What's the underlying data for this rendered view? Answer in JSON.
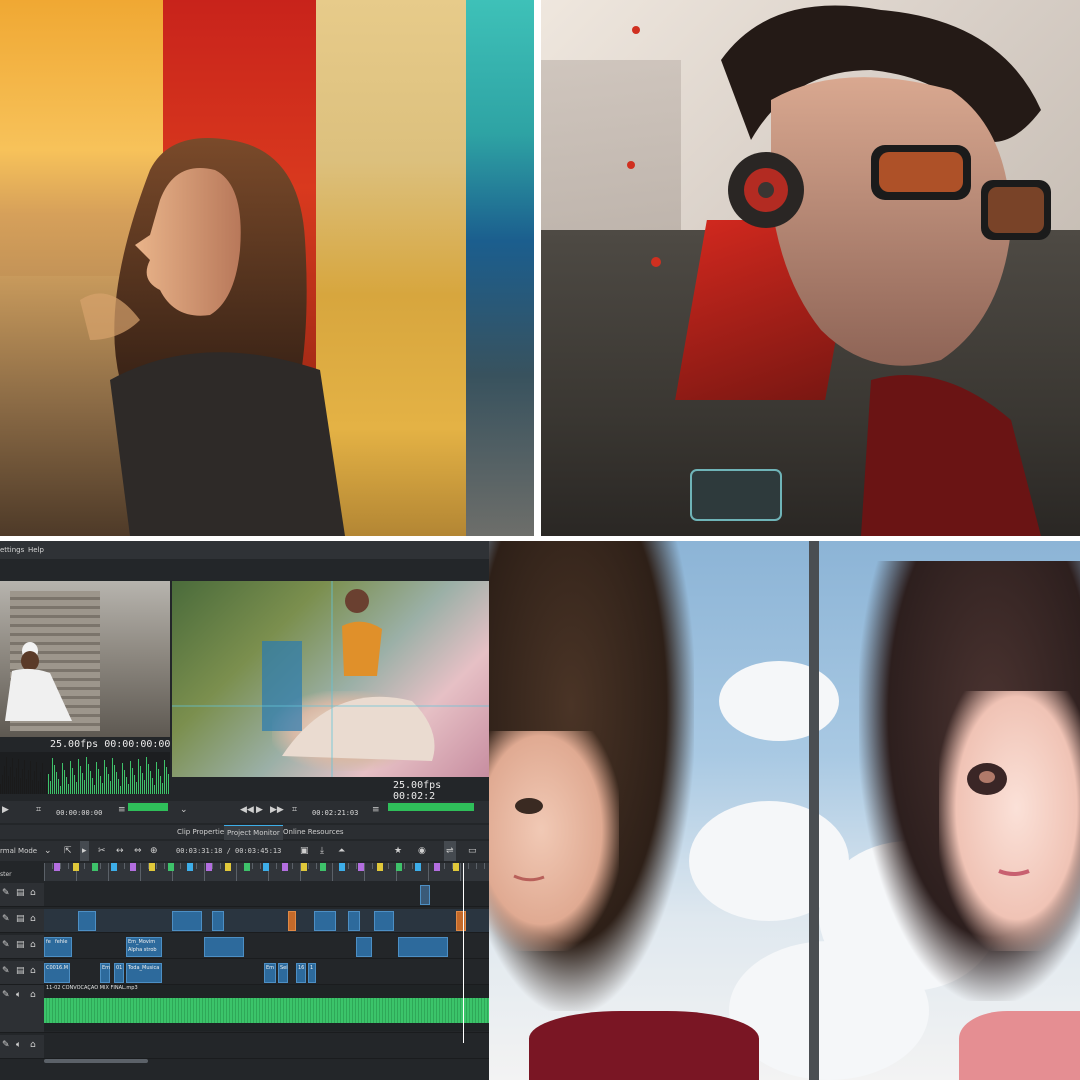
{
  "editor": {
    "menu": {
      "settings": "ettings",
      "help": "Help"
    },
    "clip_monitor": {
      "fps": "25.00fps",
      "timecode": "00:00:00:00",
      "ctrl_timecode": "00:00:00:00"
    },
    "project_monitor": {
      "fps": "25.00fps",
      "timecode": "00:02:2",
      "ctrl_timecode": "00:02:21:03"
    },
    "tabs": {
      "clip_properties": "Clip Properties",
      "project_monitor": "Project Monitor",
      "online_resources": "Online Resources"
    },
    "toolbar": {
      "mode": "rmal Mode",
      "position": "00:03:31:18 / 00:03:45:13"
    },
    "track_header": "ster",
    "clip_labels": [
      "fe",
      "fehle",
      "Em_Movim",
      "Alpha strob",
      "C0016.M",
      "Em",
      "01",
      "Toda_Musica",
      "Em",
      "Sei",
      "16",
      "1"
    ],
    "audio_clip_label": "11-02 CONVOCAÇÃO MIX FINAL.mp3",
    "audio_level": 0.7
  }
}
